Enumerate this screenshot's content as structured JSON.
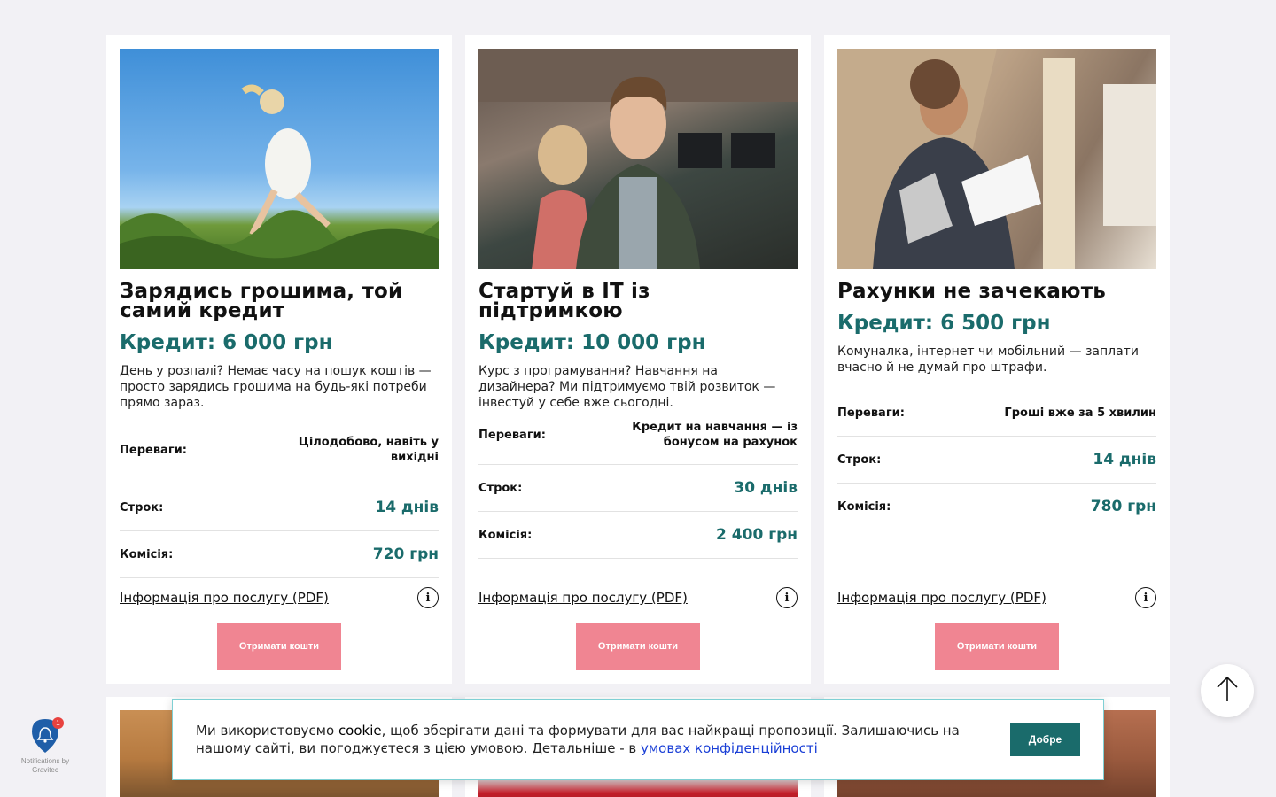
{
  "cards": [
    {
      "title": "Зарядись грошима, той самий кредит",
      "credit": "Кредит: 6 000 грн",
      "description": "День у розпалі? Немає часу на пошук коштів — просто зарядись грошима на будь-які потреби прямо зараз.",
      "advantages_label": "Переваги:",
      "advantages_value": "Цілодобово, навіть у вихідні",
      "term_label": "Строк:",
      "term_value": "14 днів",
      "fee_label": "Комісія:",
      "fee_value": "720 грн",
      "info_link": "Інформація про послугу (PDF)",
      "button": "Отримати кошти"
    },
    {
      "title": "Стартуй в IT із підтримкою",
      "credit": "Кредит: 10 000 грн",
      "description": "Курс з програмування? Навчання на дизайнера? Ми підтримуємо твій розвиток — інвестуй у себе вже сьогодні.",
      "advantages_label": "Переваги:",
      "advantages_value": "Кредит на навчання — із бонусом на рахунок",
      "term_label": "Строк:",
      "term_value": "30 днів",
      "fee_label": "Комісія:",
      "fee_value": "2 400 грн",
      "info_link": "Інформація про послугу (PDF)",
      "button": "Отримати кошти"
    },
    {
      "title": "Рахунки не зачекають",
      "credit": "Кредит: 6 500 грн",
      "description": "Комуналка, інтернет чи мобільний — заплати вчасно й не думай про штрафи.",
      "advantages_label": "Переваги:",
      "advantages_value": "Гроші вже за 5 хвилин",
      "term_label": "Строк:",
      "term_value": "14 днів",
      "fee_label": "Комісія:",
      "fee_value": "780 грн",
      "info_link": "Інформація про послугу (PDF)",
      "button": "Отримати кошти"
    }
  ],
  "cookie": {
    "text_before": "Ми використовуємо ",
    "text_cookie": "cookie",
    "text_middle": ", щоб зберігати дані та формувати для вас найкращі пропозиції. Залишаючись на нашому сайті, ви погоджуєтеся з цією умовою. Детальніше - в ",
    "link": "умовах конфіденційності",
    "button": "Добре"
  },
  "notifications": {
    "badge": "1",
    "label": "Notifications by Gravitec"
  },
  "icons": {
    "info": "info-icon",
    "scroll_top": "arrow-up-icon",
    "bell": "bell-icon"
  },
  "colors": {
    "accent": "#1a6b6b",
    "button": "#f08592",
    "background": "#f2f1f5"
  }
}
